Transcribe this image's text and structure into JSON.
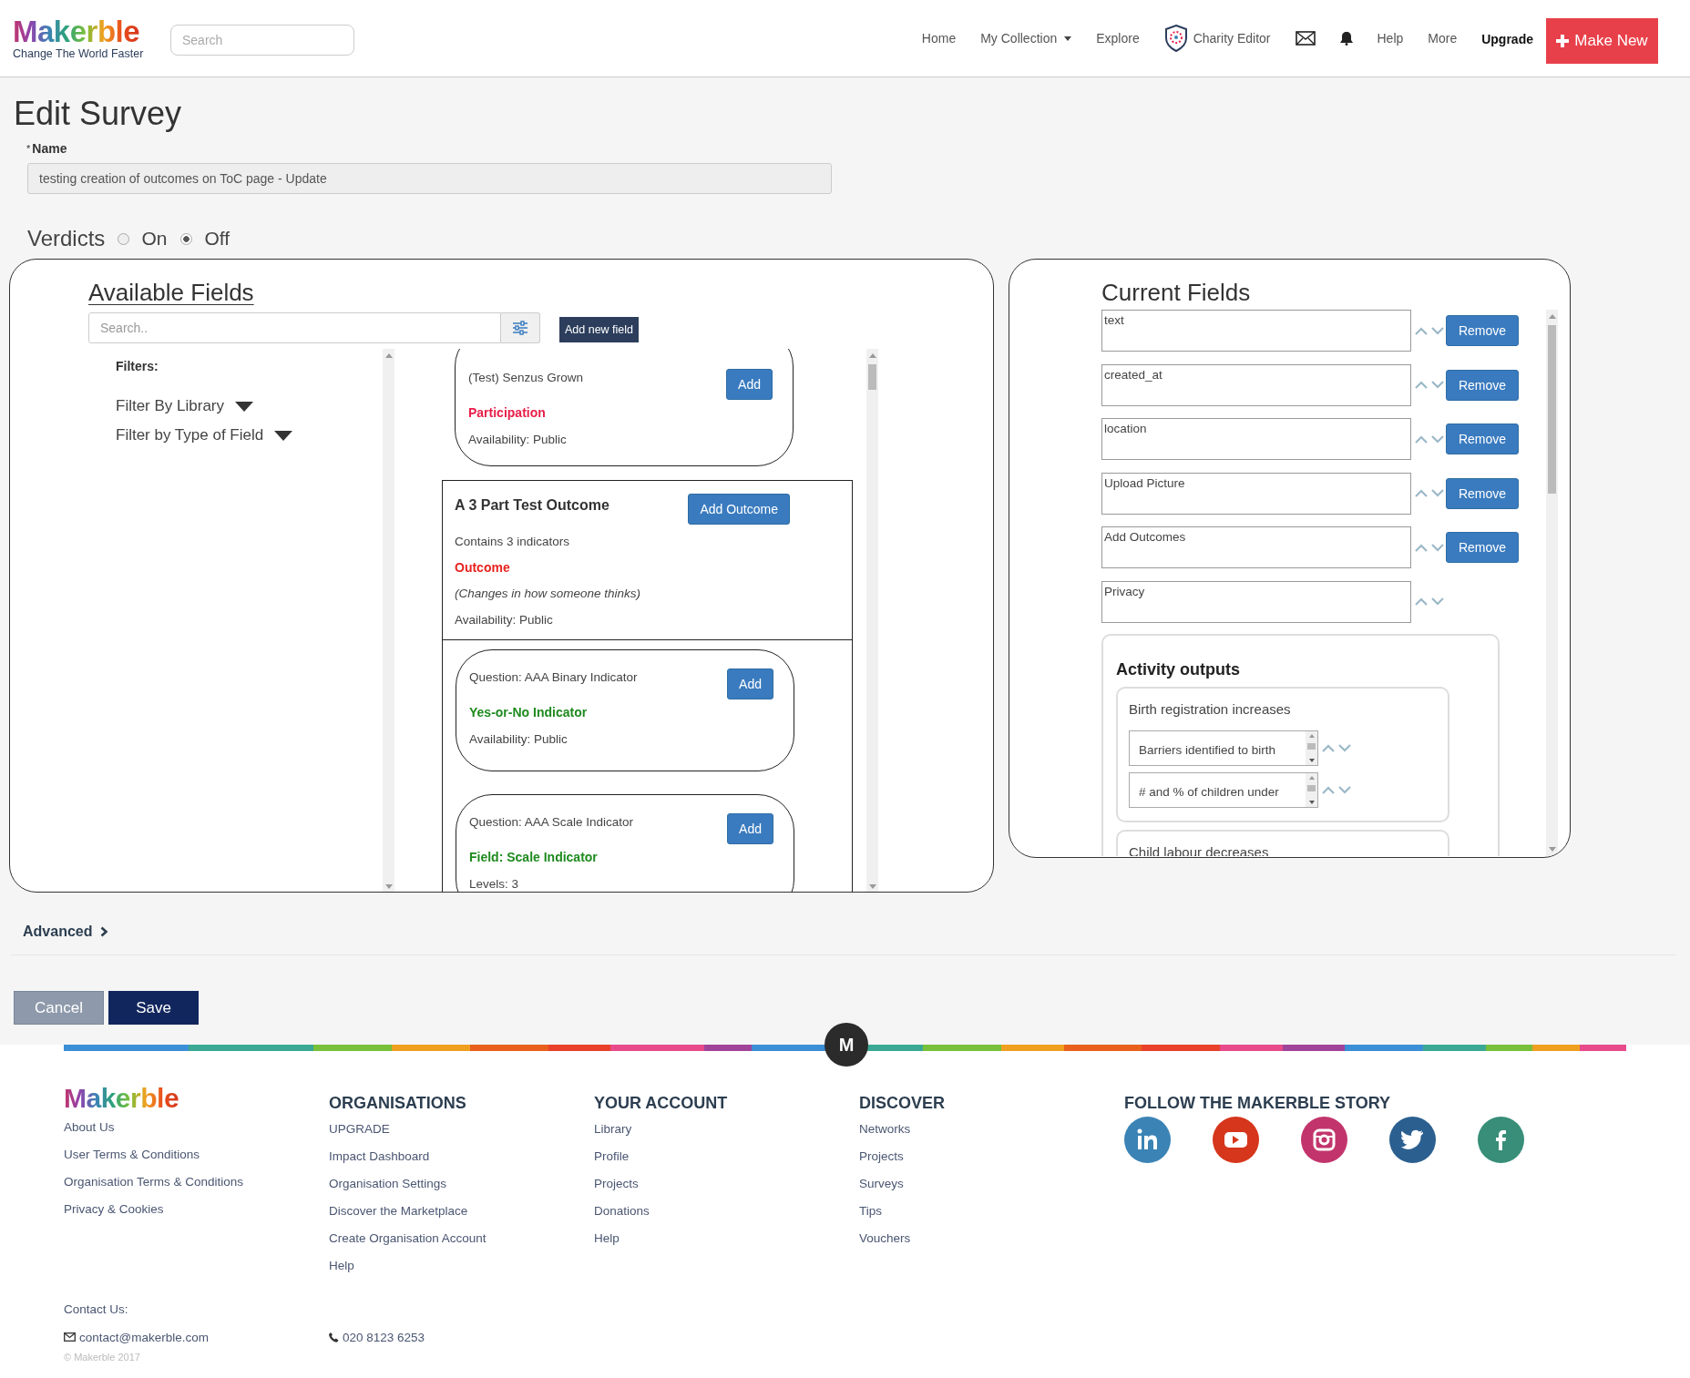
{
  "header": {
    "logo": "Makerble",
    "tagline": "Change The World Faster",
    "search_placeholder": "Search",
    "nav": [
      {
        "kind": "link",
        "label": "Home"
      },
      {
        "kind": "dropdown",
        "label": "My Collection"
      },
      {
        "kind": "link",
        "label": "Explore"
      },
      {
        "kind": "shield",
        "label": "Charity Editor"
      },
      {
        "kind": "mail"
      },
      {
        "kind": "bell"
      },
      {
        "kind": "link",
        "label": "Help"
      },
      {
        "kind": "link",
        "label": "More"
      },
      {
        "kind": "strong",
        "label": "Upgrade"
      }
    ],
    "make_new": "Make New"
  },
  "title": "Edit Survey",
  "name_field": {
    "required_mark": "*",
    "label": "Name",
    "value": "testing creation of outcomes on ToC page - Update"
  },
  "verdicts": {
    "label": "Verdicts",
    "options": [
      {
        "label": "On",
        "selected": false
      },
      {
        "label": "Off",
        "selected": true
      }
    ]
  },
  "available_fields": {
    "title": "Available Fields",
    "search_placeholder": "Search..",
    "add_button": "Add new field",
    "filters_title": "Filters:",
    "filters": [
      "Filter By Library",
      "Filter by Type of Field"
    ],
    "cards": [
      {
        "kind": "field",
        "title": "(Test) Senzus Grown",
        "button": "Add",
        "type": "Participation",
        "color": "#e8204a",
        "lines": [
          "Availability: Public"
        ]
      },
      {
        "kind": "outcome",
        "title": "A 3 Part Test Outcome",
        "button": "Add Outcome",
        "subtitle": "Contains 3 indicators",
        "type": "Outcome",
        "color": "#e8231f",
        "note": "(Changes in how someone thinks)",
        "lines": [
          "Availability: Public"
        ],
        "children": [
          {
            "kind": "field",
            "title": "Question: AAA Binary Indicator",
            "button": "Add",
            "type": "Yes-or-No Indicator",
            "color": "#1e8a1e",
            "lines": [
              "Availability: Public"
            ]
          },
          {
            "kind": "field",
            "title": "Question: AAA Scale Indicator",
            "button": "Add",
            "type": "Field: Scale Indicator",
            "color": "#1e8a1e",
            "lines": [
              "Levels: 3"
            ]
          }
        ]
      }
    ]
  },
  "current_fields": {
    "title": "Current Fields",
    "fields": [
      {
        "label": "text",
        "button": "Remove"
      },
      {
        "label": "created_at",
        "button": "Remove"
      },
      {
        "label": "location",
        "button": "Remove"
      },
      {
        "label": "Upload Picture",
        "button": "Remove"
      },
      {
        "label": "Add Outcomes",
        "button": "Remove"
      },
      {
        "label": "Privacy"
      }
    ],
    "activity_outputs": {
      "title": "Activity outputs",
      "groups": [
        {
          "title": "Birth registration increases",
          "indicators": [
            "Barriers identified to birth",
            "# and % of children under"
          ]
        },
        {
          "title": "Child labour decreases"
        }
      ]
    }
  },
  "advanced": "Advanced",
  "buttons": {
    "cancel": "Cancel",
    "save": "Save"
  },
  "footer": {
    "badge": "M",
    "logo": "Makerble",
    "columns": [
      {
        "links": [
          "About Us",
          "User Terms & Conditions",
          "Organisation Terms & Conditions",
          "Privacy & Cookies"
        ]
      },
      {
        "title": "ORGANISATIONS",
        "links": [
          "UPGRADE",
          "Impact Dashboard",
          "Organisation Settings",
          "Discover the Marketplace",
          "Create Organisation Account",
          "Help"
        ]
      },
      {
        "title": "YOUR ACCOUNT",
        "links": [
          "Library",
          "Profile",
          "Projects",
          "Donations",
          "Help"
        ]
      },
      {
        "title": "DISCOVER",
        "links": [
          "Networks",
          "Projects",
          "Surveys",
          "Tips",
          "Vouchers"
        ]
      }
    ],
    "social": {
      "title": "FOLLOW THE MAKERBLE STORY",
      "icons": [
        {
          "kind": "linkedin",
          "color": "#3b83b5"
        },
        {
          "kind": "youtube",
          "color": "#d5361c"
        },
        {
          "kind": "instagram",
          "color": "#c2356c"
        },
        {
          "kind": "twitter",
          "color": "#2b5f8f"
        },
        {
          "kind": "facebook",
          "color": "#388e78"
        }
      ]
    },
    "contact_title": "Contact Us:",
    "email": "contact@makerble.com",
    "phone": "020 8123 6253",
    "copyright": "© Makerble 2017"
  }
}
